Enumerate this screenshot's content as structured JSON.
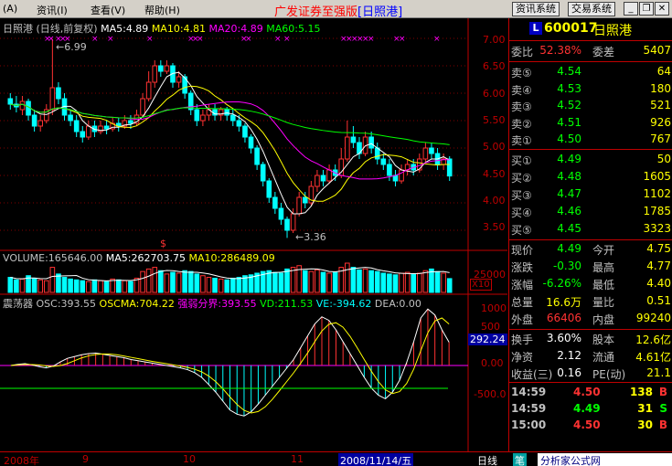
{
  "menu": {
    "items": [
      "(A)",
      "资讯(I)",
      "查看(V)",
      "帮助(H)"
    ],
    "title_prefix": "广发证券至强版",
    "title_stock": "[日照港]",
    "btn_info": "资讯系统",
    "btn_trade": "交易系统",
    "min": "_",
    "restore": "❐",
    "close": "✕"
  },
  "chart": {
    "price_legend": {
      "name": "日照港",
      "period": "(日线,前复权)",
      "ma5": "MA5:4.89",
      "ma10": "MA10:4.81",
      "ma20": "MA20:4.89",
      "ma60": "MA60:5.15"
    },
    "price_axis": [
      "7.00",
      "6.50",
      "6.00",
      "5.50",
      "5.00",
      "4.50",
      "4.00",
      "3.50"
    ],
    "annot_high": "6.99",
    "annot_low": "3.36",
    "volume_legend": {
      "vol": "VOLUME:165646.00",
      "ma5": "MA5:262703.75",
      "ma10": "MA10:286489.09"
    },
    "volume_axis_label": "25000",
    "volume_unit": "X10",
    "osc_legend": {
      "name": "震荡器",
      "osc": "OSC:393.55",
      "oscma": "OSCMA:704.22",
      "split": "强弱分界:393.55",
      "vd": "VD:211.53",
      "ve": "VE:-394.62",
      "dea": "DEA:0.00"
    },
    "osc_axis": [
      "1000",
      "500",
      "0.00",
      "-500.0"
    ],
    "osc_marker": "292.24",
    "colors": {
      "up": "#ff3232",
      "down": "#00ffff",
      "ma5": "#ffffff",
      "ma10": "#ffff00",
      "ma20": "#ff00ff",
      "ma60": "#00ff00",
      "grid": "#800000"
    }
  },
  "chart_data": {
    "type": "candlestick",
    "price_axis_range": [
      3.2,
      7.2
    ],
    "candles": [
      [
        5.9,
        5.8,
        6.0,
        5.7
      ],
      [
        5.8,
        5.75,
        5.95,
        5.65
      ],
      [
        5.7,
        5.85,
        5.95,
        5.6
      ],
      [
        5.85,
        5.6,
        5.9,
        5.5
      ],
      [
        5.6,
        5.4,
        5.7,
        5.3
      ],
      [
        5.4,
        5.5,
        5.6,
        5.3
      ],
      [
        5.5,
        5.7,
        5.8,
        5.45
      ],
      [
        5.7,
        6.1,
        6.99,
        5.6
      ],
      [
        6.1,
        5.9,
        6.2,
        5.8
      ],
      [
        5.9,
        5.6,
        6.0,
        5.5
      ],
      [
        5.6,
        5.5,
        5.7,
        5.4
      ],
      [
        5.5,
        5.3,
        5.6,
        5.2
      ],
      [
        5.3,
        5.2,
        5.4,
        5.1
      ],
      [
        5.2,
        5.4,
        5.5,
        5.15
      ],
      [
        5.4,
        5.3,
        5.5,
        5.2
      ],
      [
        5.3,
        5.4,
        5.5,
        5.25
      ],
      [
        5.4,
        5.35,
        5.5,
        5.25
      ],
      [
        5.35,
        5.45,
        5.55,
        5.3
      ],
      [
        5.45,
        5.4,
        5.55,
        5.3
      ],
      [
        5.4,
        5.5,
        5.6,
        5.35
      ],
      [
        5.5,
        5.45,
        5.6,
        5.35
      ],
      [
        5.45,
        5.6,
        5.7,
        5.4
      ],
      [
        5.6,
        5.9,
        6.0,
        5.55
      ],
      [
        5.9,
        6.2,
        6.4,
        5.85
      ],
      [
        6.2,
        6.5,
        6.6,
        6.1
      ],
      [
        6.5,
        6.4,
        6.6,
        6.3
      ],
      [
        6.4,
        6.5,
        6.6,
        6.35
      ],
      [
        6.5,
        6.2,
        6.55,
        6.1
      ],
      [
        6.2,
        6.3,
        6.4,
        6.1
      ],
      [
        6.3,
        6.0,
        6.35,
        5.9
      ],
      [
        6.0,
        5.7,
        6.05,
        5.6
      ],
      [
        5.7,
        5.5,
        5.8,
        5.4
      ],
      [
        5.5,
        5.6,
        5.7,
        5.4
      ],
      [
        5.6,
        5.7,
        5.8,
        5.5
      ],
      [
        5.7,
        5.6,
        5.8,
        5.5
      ],
      [
        5.6,
        5.7,
        5.75,
        5.5
      ],
      [
        5.7,
        5.6,
        5.75,
        5.5
      ],
      [
        5.6,
        5.5,
        5.7,
        5.4
      ],
      [
        5.5,
        5.4,
        5.6,
        5.3
      ],
      [
        5.4,
        5.2,
        5.45,
        5.1
      ],
      [
        5.2,
        5.0,
        5.25,
        4.9
      ],
      [
        5.0,
        4.7,
        5.05,
        4.6
      ],
      [
        4.7,
        4.4,
        4.75,
        4.3
      ],
      [
        4.4,
        4.1,
        4.45,
        4.0
      ],
      [
        4.1,
        3.9,
        4.2,
        3.8
      ],
      [
        3.9,
        3.7,
        4.0,
        3.6
      ],
      [
        3.7,
        3.5,
        3.75,
        3.36
      ],
      [
        3.5,
        3.8,
        3.9,
        3.45
      ],
      [
        3.8,
        4.1,
        4.2,
        3.75
      ],
      [
        4.1,
        4.0,
        4.2,
        3.9
      ],
      [
        4.0,
        4.3,
        4.4,
        3.95
      ],
      [
        4.3,
        4.5,
        4.6,
        4.2
      ],
      [
        4.5,
        4.4,
        4.6,
        4.3
      ],
      [
        4.4,
        4.6,
        4.7,
        4.35
      ],
      [
        4.6,
        4.5,
        4.7,
        4.4
      ],
      [
        4.5,
        4.8,
        5.0,
        4.45
      ],
      [
        4.8,
        5.2,
        5.5,
        4.75
      ],
      [
        5.2,
        5.1,
        5.4,
        5.0
      ],
      [
        5.1,
        4.9,
        5.2,
        4.8
      ],
      [
        4.9,
        5.2,
        5.3,
        4.85
      ],
      [
        5.2,
        5.0,
        5.3,
        4.9
      ],
      [
        5.0,
        4.8,
        5.1,
        4.7
      ],
      [
        4.8,
        4.7,
        4.9,
        4.6
      ],
      [
        4.7,
        4.5,
        4.8,
        4.4
      ],
      [
        4.5,
        4.4,
        4.6,
        4.3
      ],
      [
        4.4,
        4.6,
        4.7,
        4.35
      ],
      [
        4.6,
        4.7,
        4.8,
        4.5
      ],
      [
        4.7,
        4.6,
        4.8,
        4.5
      ],
      [
        4.6,
        4.8,
        4.9,
        4.55
      ],
      [
        4.8,
        5.0,
        5.1,
        4.75
      ],
      [
        5.0,
        4.9,
        5.1,
        4.8
      ],
      [
        4.9,
        4.7,
        5.0,
        4.6
      ],
      [
        4.7,
        4.8,
        4.9,
        4.6
      ],
      [
        4.8,
        4.49,
        4.85,
        4.4
      ]
    ],
    "volumes": [
      180,
      150,
      160,
      200,
      170,
      150,
      140,
      300,
      220,
      180,
      160,
      150,
      140,
      130,
      150,
      140,
      130,
      160,
      150,
      140,
      130,
      170,
      250,
      280,
      300,
      260,
      220,
      240,
      230,
      260,
      250,
      220,
      200,
      180,
      170,
      160,
      150,
      170,
      180,
      200,
      210,
      230,
      250,
      260,
      240,
      230,
      280,
      300,
      320,
      260,
      250,
      270,
      240,
      230,
      240,
      300,
      350,
      300,
      270,
      280,
      260,
      250,
      230,
      220,
      210,
      230,
      240,
      220,
      230,
      260,
      280,
      250,
      230,
      165
    ],
    "osc": [
      0,
      20,
      30,
      10,
      -20,
      -40,
      -10,
      60,
      120,
      150,
      180,
      200,
      210,
      190,
      170,
      150,
      130,
      100,
      80,
      60,
      40,
      20,
      0,
      -20,
      -40,
      -70,
      -120,
      -200,
      -320,
      -450,
      -600,
      -750,
      -820,
      -850,
      -780,
      -650,
      -500,
      -350,
      -200,
      -50,
      100,
      300,
      500,
      700,
      820,
      760,
      600,
      400,
      200,
      0,
      -200,
      -380,
      -500,
      -560,
      -450,
      -250,
      50,
      400,
      800,
      950,
      850,
      600,
      393
    ]
  },
  "quote": {
    "code_badge": "L",
    "code": "600017",
    "name": "日照港",
    "weibi_label": "委比",
    "weibi": "52.38%",
    "weicha_label": "委差",
    "weicha": "5407",
    "asks": [
      {
        "label": "卖⑤",
        "price": "4.54",
        "vol": "64"
      },
      {
        "label": "卖④",
        "price": "4.53",
        "vol": "180"
      },
      {
        "label": "卖③",
        "price": "4.52",
        "vol": "521"
      },
      {
        "label": "卖②",
        "price": "4.51",
        "vol": "926"
      },
      {
        "label": "卖①",
        "price": "4.50",
        "vol": "767"
      }
    ],
    "bids": [
      {
        "label": "买①",
        "price": "4.49",
        "vol": "50"
      },
      {
        "label": "买②",
        "price": "4.48",
        "vol": "1605"
      },
      {
        "label": "买③",
        "price": "4.47",
        "vol": "1102"
      },
      {
        "label": "买④",
        "price": "4.46",
        "vol": "1785"
      },
      {
        "label": "买⑤",
        "price": "4.45",
        "vol": "3323"
      }
    ],
    "stats": [
      {
        "l1": "现价",
        "v1": "4.49",
        "c1": "g",
        "l2": "今开",
        "v2": "4.75",
        "c2": "r"
      },
      {
        "l1": "涨跌",
        "v1": "-0.30",
        "c1": "g",
        "l2": "最高",
        "v2": "4.77",
        "c2": "r"
      },
      {
        "l1": "涨幅",
        "v1": "-6.26%",
        "c1": "g",
        "l2": "最低",
        "v2": "4.40",
        "c2": "g"
      },
      {
        "l1": "总量",
        "v1": "16.6万",
        "c1": "y",
        "l2": "量比",
        "v2": "0.51",
        "c2": "y"
      },
      {
        "l1": "外盘",
        "v1": "66406",
        "c1": "r",
        "l2": "内盘",
        "v2": "99240",
        "c2": "g"
      }
    ],
    "stats2": [
      {
        "l1": "换手",
        "v1": "3.60%",
        "c1": "w",
        "l2": "股本",
        "v2": "12.6亿",
        "c2": "w"
      },
      {
        "l1": "净资",
        "v1": "2.12",
        "c1": "w",
        "l2": "流通",
        "v2": "4.61亿",
        "c2": "w"
      },
      {
        "l1": "收益(三)",
        "v1": "0.16",
        "c1": "w",
        "l2": "PE(动)",
        "v2": "21.1",
        "c2": "w"
      }
    ],
    "ticks": [
      {
        "time": "14:59",
        "price": "4.50",
        "vol": "138",
        "side": "B",
        "pc": "r",
        "sc": "r"
      },
      {
        "time": "14:59",
        "price": "4.49",
        "vol": "31",
        "side": "S",
        "pc": "g",
        "sc": "g"
      },
      {
        "time": "15:00",
        "price": "4.50",
        "vol": "30",
        "side": "B",
        "pc": "r",
        "sc": "r"
      }
    ]
  },
  "status": {
    "year": "2008年",
    "m9": "9",
    "m10": "10",
    "m11": "11",
    "cursor_date": "2008/11/14/五",
    "period": "日线",
    "pen": "笔",
    "watermark": "分析家公式网www.88gg.com"
  }
}
